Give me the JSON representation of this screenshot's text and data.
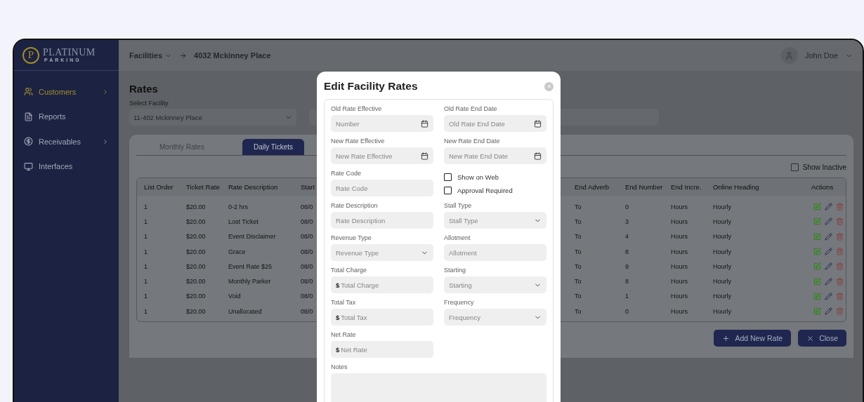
{
  "logo": {
    "mark": "P",
    "name": "PLATINUM",
    "sub": "PARKING"
  },
  "sidebar": {
    "items": [
      {
        "label": "Customers",
        "selected": true,
        "has_submenu": true
      },
      {
        "label": "Reports",
        "selected": false,
        "has_submenu": false
      },
      {
        "label": "Receivables",
        "selected": false,
        "has_submenu": true
      },
      {
        "label": "Interfaces",
        "selected": false,
        "has_submenu": false
      }
    ]
  },
  "topbar": {
    "breadcrumb": [
      "Facilities",
      "4032 Mckinney Place"
    ],
    "user": "John Doe"
  },
  "page": {
    "title": "Rates",
    "facility_label": "Select Facility",
    "facility_value": "11-402 Mckinney Place"
  },
  "tabs": [
    {
      "label": "Monthly Rates",
      "selected": false
    },
    {
      "label": "Daily Tickets",
      "selected": true
    }
  ],
  "show_inactive": {
    "label": "Show Inactive",
    "checked": false
  },
  "table": {
    "columns": [
      "List Order",
      "Ticket Rate",
      "Rate Description",
      "Start",
      "End Adverb",
      "End Number",
      "End Incre.",
      "Online Heading"
    ],
    "actions_column": "Actions",
    "rows": [
      [
        "1",
        "$20.00",
        "0-2 hrs",
        "08/0",
        "To",
        "0",
        "Hours",
        "Hourly"
      ],
      [
        "1",
        "$20.00",
        "Lost Ticket",
        "08/0",
        "To",
        "3",
        "Hours",
        "Hourly"
      ],
      [
        "1",
        "$20.00",
        "Event Disclaimer",
        "08/0",
        "To",
        "4",
        "Hours",
        "Hourly"
      ],
      [
        "1",
        "$20.00",
        "Grace",
        "08/0",
        "To",
        "8",
        "Hours",
        "Hourly"
      ],
      [
        "1",
        "$20.00",
        "Event Rate $25",
        "08/0",
        "To",
        "9",
        "Hours",
        "Hourly"
      ],
      [
        "1",
        "$20.00",
        "Monthly Parker",
        "08/0",
        "To",
        "8",
        "Hours",
        "Hourly"
      ],
      [
        "1",
        "$20.00",
        "Void",
        "08/0",
        "To",
        "1",
        "Hours",
        "Hourly"
      ],
      [
        "1",
        "$20.00",
        "Unallocated",
        "08/0",
        "To",
        "0",
        "Hours",
        "Hourly"
      ]
    ]
  },
  "buttons": [
    {
      "label": "Add New Rate",
      "kind": "add"
    },
    {
      "label": "Close",
      "kind": "close"
    }
  ],
  "modal": {
    "title": "Edit Facility Rates",
    "fields": [
      {
        "kind": "date",
        "label": "Old Rate Effective",
        "placeholder": "Number"
      },
      {
        "kind": "date",
        "label": "Old Rate End Date",
        "placeholder": "Old Rate End Date"
      },
      {
        "kind": "date",
        "label": "New Rate Effective",
        "placeholder": "New Rate Effective"
      },
      {
        "kind": "date",
        "label": "New Rate End Date",
        "placeholder": "New Rate End Date"
      },
      {
        "kind": "text",
        "label": "Rate Code",
        "placeholder": "Rate Code"
      },
      {
        "kind": "checks",
        "options": [
          {
            "label": "Show on Web",
            "checked": false
          },
          {
            "label": "Approval Required",
            "checked": false
          }
        ]
      },
      {
        "kind": "text",
        "label": "Rate Description",
        "placeholder": "Rate Description"
      },
      {
        "kind": "select",
        "label": "Stall Type",
        "placeholder": "Stall Type"
      },
      {
        "kind": "select",
        "label": "Revenue Type",
        "placeholder": "Revenue Type"
      },
      {
        "kind": "text",
        "label": "Allotment",
        "placeholder": "Allotment"
      },
      {
        "kind": "money",
        "label": "Total Charge",
        "prefix": "$",
        "placeholder": "Total Charge"
      },
      {
        "kind": "select",
        "label": "Starting",
        "placeholder": "Starting"
      },
      {
        "kind": "money",
        "label": "Total Tax",
        "prefix": "$",
        "placeholder": "Total Tax"
      },
      {
        "kind": "select",
        "label": "Frequency",
        "placeholder": "Frequency"
      },
      {
        "kind": "money",
        "label": "Net Rate",
        "prefix": "$",
        "placeholder": "Net Rate"
      },
      {
        "kind": "textarea",
        "label": "Notes"
      }
    ]
  }
}
